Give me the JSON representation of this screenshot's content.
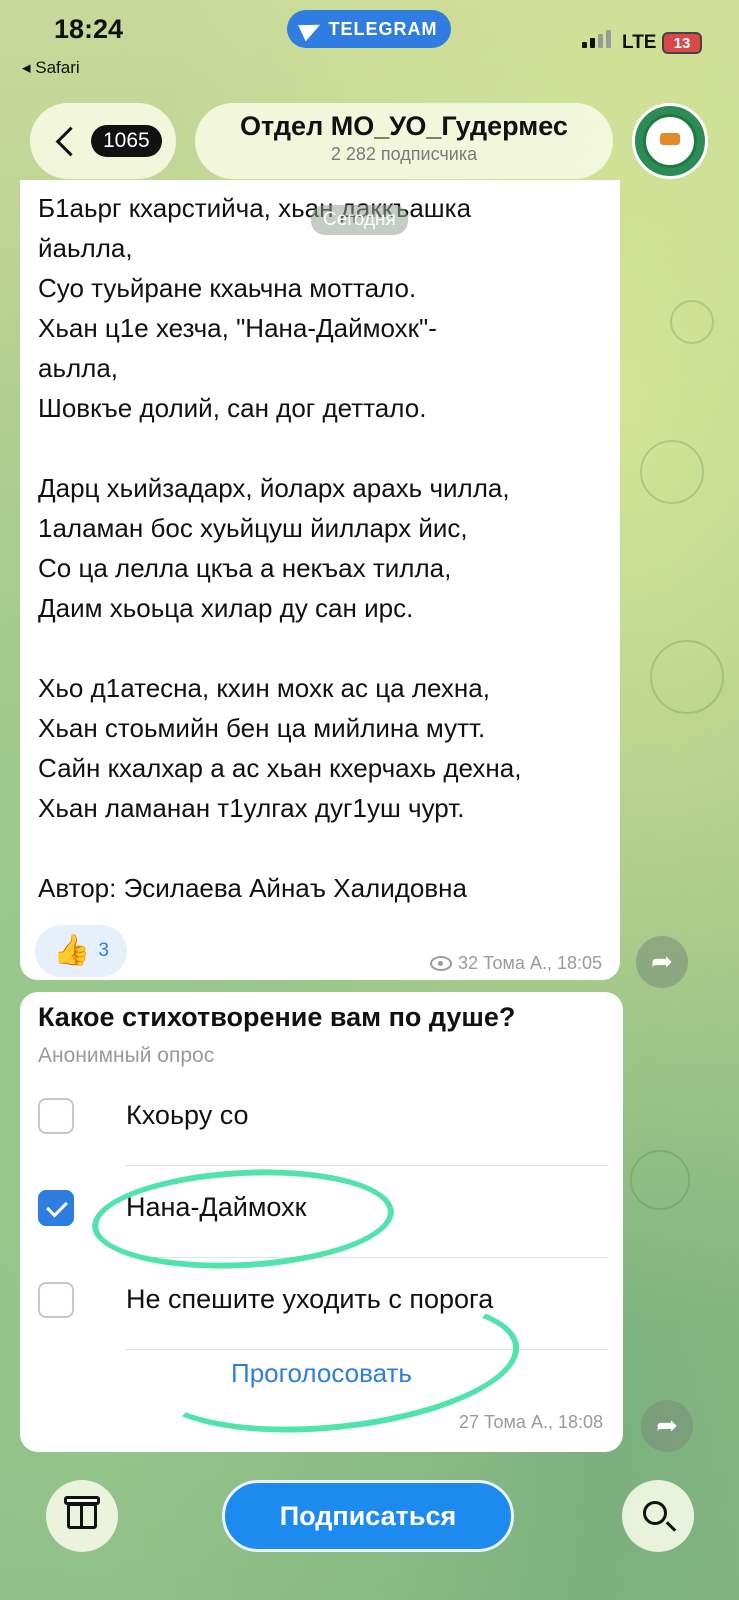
{
  "status_bar": {
    "time": "18:24",
    "back_app": "◂ Safari",
    "app_pill": "TELEGRAM",
    "network": "LTE",
    "battery": "13"
  },
  "header": {
    "unread_count": "1065",
    "channel_title": "Отдел МО_УО_Гудермес",
    "subscribers": "2 282 подписчика"
  },
  "date_chip": "Сегодня",
  "message": {
    "lines": [
      "Б1аьрг кхарстийча, хьан даккъашка",
      "йаьлла,",
      "Суо туьйране кхаьчна моттало.",
      "Хьан ц1е хезча, \"Нана-Даймохк\"-",
      "аьлла,",
      "Шовкъе долий, сан дог деттало.",
      "",
      "Дарц хьийзадарх, йоларх арахь чилла,",
      "1аламан бос хуьйцуш йилларх йис,",
      "Со ца лелла цкъа а некъах тилла,",
      "Даим хьоьца хилар ду сан ирс.",
      "",
      "Хьо д1атесна, кхин мохк ас ца лехна,",
      "Хьан стоьмийн бен ца мийлина мутт.",
      "Сайн кхалхар а ас хьан кхерчахь дехна,",
      "Хьан ламанан т1улгах дуг1уш чурт.",
      "",
      "Автор: Эсилаева Айнаъ Халидовна"
    ],
    "reaction_emoji": "👍",
    "reaction_count": "3",
    "views_meta": "32 Тома А., 18:05"
  },
  "poll": {
    "question": "Какое стихотворение вам по душе?",
    "type": "Анонимный опрос",
    "options": [
      {
        "label": "Кхоьру со",
        "checked": false
      },
      {
        "label": "Нана-Даймохк",
        "checked": true
      },
      {
        "label": "Не спешите уходить с порога",
        "checked": false
      }
    ],
    "vote_button": "Проголосовать",
    "meta": "27 Тома А., 18:08"
  },
  "bottom": {
    "subscribe": "Подписаться"
  },
  "colors": {
    "accent": "#2f7de0",
    "annotation": "#3fe0a4"
  }
}
